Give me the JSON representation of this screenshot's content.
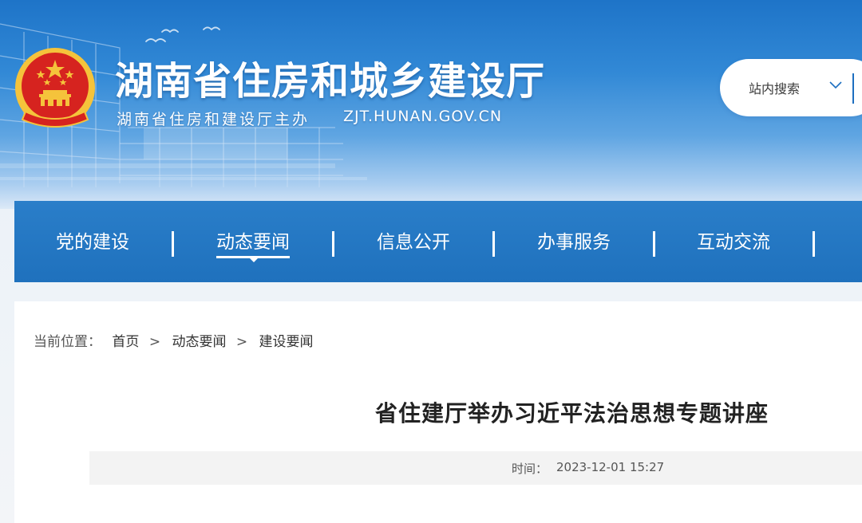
{
  "header": {
    "site_title": "湖南省住房和城乡建设厅",
    "site_subtitle": "湖南省住房和建设厅主办",
    "site_url": "ZJT.HUNAN.GOV.CN",
    "search": {
      "selected_scope": "站内搜索",
      "icon": "chevron-down-icon"
    },
    "emblem_icon": "national-emblem-icon"
  },
  "nav": {
    "items": [
      {
        "label": "党的建设"
      },
      {
        "label": "动态要闻",
        "active": true
      },
      {
        "label": "信息公开"
      },
      {
        "label": "办事服务"
      },
      {
        "label": "互动交流"
      }
    ]
  },
  "breadcrumb": {
    "prefix": "当前位置：",
    "items": [
      "首页",
      "动态要闻",
      "建设要闻"
    ],
    "separator": ">"
  },
  "article": {
    "title": "省住建厅举办习近平法治思想专题讲座",
    "time_label": "时间：",
    "time_value": "2023-12-01 15:27"
  },
  "colors": {
    "banner_blue": "#1e74c8",
    "nav_blue": "#2478c4",
    "emblem_red": "#d6231f",
    "emblem_gold": "#f5c33b"
  }
}
